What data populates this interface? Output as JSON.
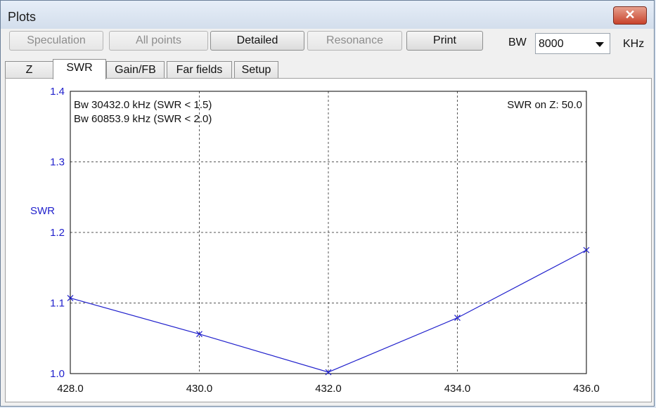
{
  "window": {
    "title": "Plots"
  },
  "toolbar": {
    "buttons": [
      {
        "label": "Speculation",
        "disabled": true
      },
      {
        "label": "All points",
        "disabled": true
      },
      {
        "label": "Detailed",
        "disabled": false
      },
      {
        "label": "Resonance",
        "disabled": true
      },
      {
        "label": "Print",
        "disabled": false
      }
    ],
    "bw_label": "BW",
    "bw_value": "8000",
    "bw_unit": "KHz"
  },
  "tabs": [
    {
      "label": "Z",
      "active": false
    },
    {
      "label": "SWR",
      "active": true
    },
    {
      "label": "Gain/FB",
      "active": false
    },
    {
      "label": "Far fields",
      "active": false
    },
    {
      "label": "Setup",
      "active": false
    }
  ],
  "chart_data": {
    "type": "line",
    "ylabel": "SWR",
    "xlim": [
      428.0,
      436.0
    ],
    "ylim": [
      1.0,
      1.4
    ],
    "xticks": [
      "428.0",
      "430.0",
      "432.0",
      "434.0",
      "436.0"
    ],
    "yticks": [
      "1.0",
      "1.1",
      "1.2",
      "1.3",
      "1.4"
    ],
    "grid": true,
    "series": [
      {
        "x": [
          428.0,
          430.0,
          432.0,
          434.0,
          436.0
        ],
        "y": [
          1.107,
          1.056,
          1.002,
          1.079,
          1.175
        ],
        "color": "#1f1fcc",
        "marker": "x"
      }
    ],
    "annotations": {
      "bw_lines": [
        "Bw 30432.0 kHz (SWR < 1.5)",
        "Bw 60853.9 kHz (SWR < 2.0)"
      ],
      "swr_on_z": "SWR on Z: 50.0"
    }
  }
}
